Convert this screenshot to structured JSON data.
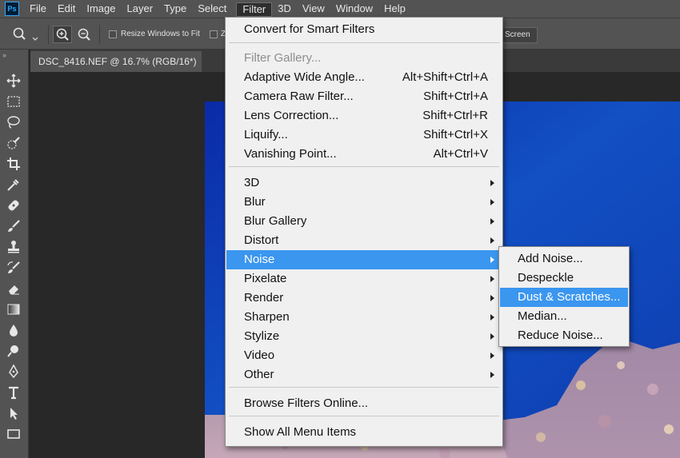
{
  "menubar": {
    "logo": "Ps",
    "items": [
      "File",
      "Edit",
      "Image",
      "Layer",
      "Type",
      "Select",
      "Filter",
      "3D",
      "View",
      "Window",
      "Help"
    ],
    "active": "Filter"
  },
  "options": {
    "resize_windows": "Resize Windows to Fit",
    "partial_z": "Z",
    "screen_button": "Screen"
  },
  "document": {
    "tab_title": "DSC_8416.NEF @ 16.7% (RGB/16*)"
  },
  "filter_menu": {
    "convert": "Convert for Smart Filters",
    "filter_gallery": "Filter Gallery...",
    "adaptive_wide_angle": {
      "label": "Adaptive Wide Angle...",
      "shortcut": "Alt+Shift+Ctrl+A"
    },
    "camera_raw": {
      "label": "Camera Raw Filter...",
      "shortcut": "Shift+Ctrl+A"
    },
    "lens_correction": {
      "label": "Lens Correction...",
      "shortcut": "Shift+Ctrl+R"
    },
    "liquify": {
      "label": "Liquify...",
      "shortcut": "Shift+Ctrl+X"
    },
    "vanishing_point": {
      "label": "Vanishing Point...",
      "shortcut": "Alt+Ctrl+V"
    },
    "groups": [
      "3D",
      "Blur",
      "Blur Gallery",
      "Distort",
      "Noise",
      "Pixelate",
      "Render",
      "Sharpen",
      "Stylize",
      "Video",
      "Other"
    ],
    "highlighted": "Noise",
    "browse_online": "Browse Filters Online...",
    "show_all": "Show All Menu Items"
  },
  "noise_submenu": {
    "items": [
      "Add Noise...",
      "Despeckle",
      "Dust & Scratches...",
      "Median...",
      "Reduce Noise..."
    ],
    "highlighted": "Dust & Scratches..."
  },
  "colors": {
    "menu_highlight": "#3b96ef",
    "ui_panel": "#535353",
    "workspace": "#282828",
    "menu_bg": "#f0f0f0"
  },
  "icons": [
    "photoshop-logo-icon",
    "zoom-tool-icon",
    "zoom-in-icon",
    "zoom-out-icon",
    "move-tool-icon",
    "marquee-tool-icon",
    "lasso-tool-icon",
    "quick-selection-tool-icon",
    "crop-tool-icon",
    "eyedropper-tool-icon",
    "healing-brush-icon",
    "brush-tool-icon",
    "clone-stamp-icon",
    "history-brush-icon",
    "eraser-tool-icon",
    "gradient-tool-icon",
    "blur-tool-icon",
    "dodge-tool-icon",
    "pen-tool-icon",
    "type-tool-icon",
    "path-selection-icon",
    "rectangle-tool-icon",
    "submenu-arrow-icon"
  ]
}
